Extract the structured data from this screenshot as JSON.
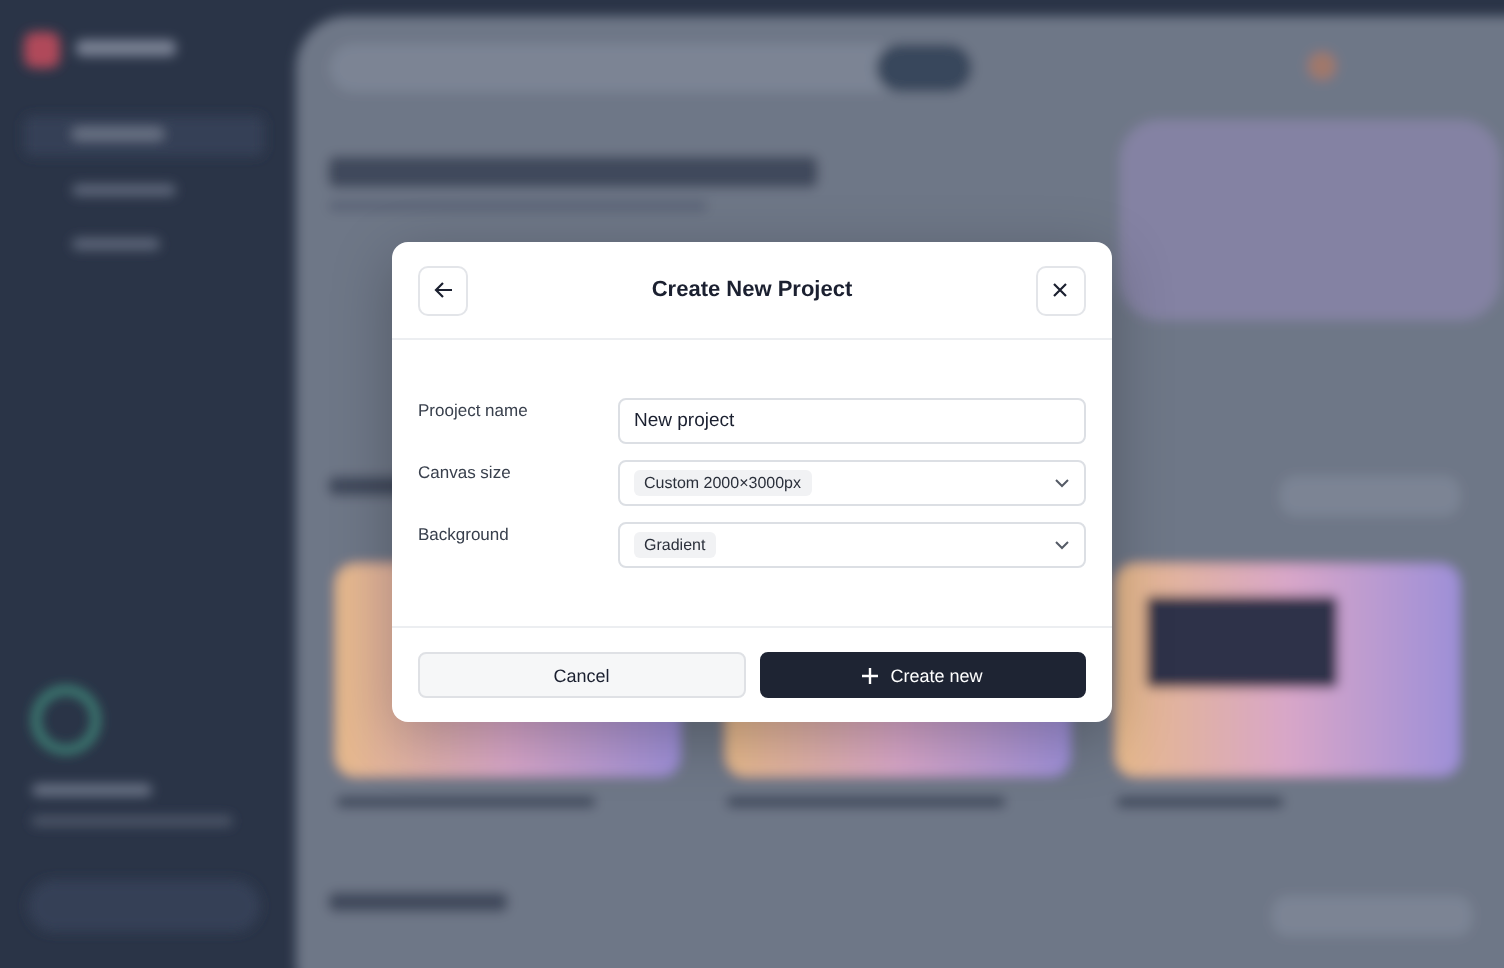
{
  "dialog": {
    "title": "Create New Project",
    "fields": [
      {
        "kind": "text",
        "label": "Prooject name",
        "value": "New project"
      },
      {
        "kind": "select",
        "label": "Canvas size",
        "value": "Custom 2000×3000px"
      },
      {
        "kind": "select",
        "label": "Background",
        "value": "Gradient"
      }
    ],
    "buttons": [
      {
        "kind": "secondary",
        "label": "Cancel"
      },
      {
        "kind": "primary",
        "label": "Create new"
      }
    ]
  }
}
